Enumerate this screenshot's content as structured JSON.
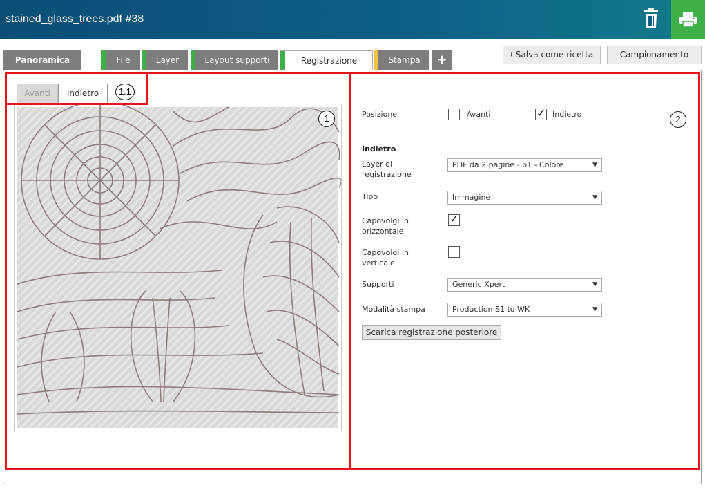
{
  "window": {
    "title": "stained_glass_trees.pdf #38"
  },
  "icons": {
    "trash": "trash-icon",
    "print": "printer-icon",
    "download": "download-icon",
    "plus": "plus-icon",
    "dropdown": "chevron-down-icon"
  },
  "colors": {
    "titlebar": "#0b4e74",
    "print_button": "#3faf4a",
    "tab_green": "#3faf4a",
    "tab_yellow": "#f5c243",
    "tab_dark": "#7d7d7d",
    "highlight_red": "#e8121b"
  },
  "tabs": [
    {
      "label": "Panoramica"
    },
    {
      "label": "File"
    },
    {
      "label": "Layer"
    },
    {
      "label": "Layout supporti"
    },
    {
      "label": "Registrazione"
    },
    {
      "label": "Stampa"
    }
  ],
  "toolbar": {
    "save_recipe": "Salva come ricetta",
    "sampling": "Campionamento"
  },
  "preview": {
    "tab_front": "Avanti",
    "tab_back": "Indietro",
    "active_tab": "Indietro"
  },
  "callouts": {
    "tabs": "1.1",
    "preview": "1",
    "settings": "2"
  },
  "settings": {
    "position_label": "Posizione",
    "front_option": "Avanti",
    "front_checked": false,
    "back_option": "Indietro",
    "back_checked": true,
    "section_title": "Indietro",
    "layer_label_1": "Layer di",
    "layer_label_2": "registrazione",
    "layer_value": "PDF da 2 pagine - p1 - Colore",
    "type_label": "Tipo",
    "type_value": "Immagine",
    "flip_h_label_1": "Capovolgi in",
    "flip_h_label_2": "orizzontale",
    "flip_h_checked": true,
    "flip_v_label_1": "Capovolgi in",
    "flip_v_label_2": "verticale",
    "flip_v_checked": false,
    "media_label": "Supporti",
    "media_value": "Generic Xpert",
    "print_mode_label": "Modalità stampa",
    "print_mode_value": "Production S1 to WK",
    "download_button": "Scarica registrazione posteriore"
  }
}
